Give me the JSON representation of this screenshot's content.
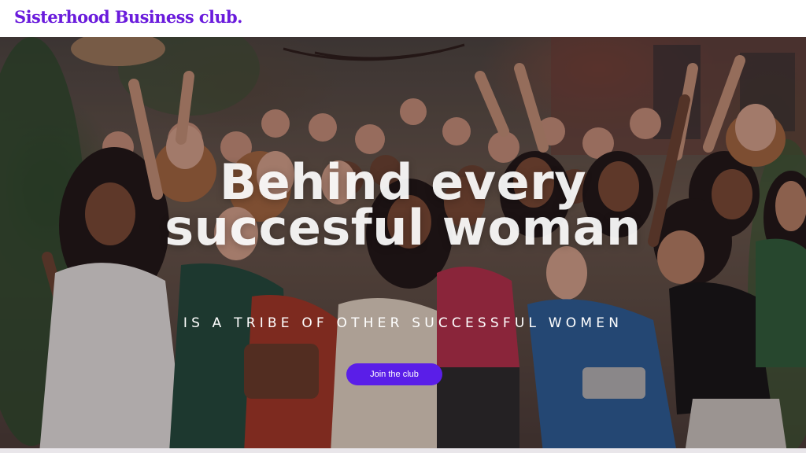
{
  "header": {
    "logo_text": "Sisterhood Business club."
  },
  "hero": {
    "headline_line1": "Behind every",
    "headline_line2": "succesful woman",
    "tagline": "IS A TRIBE OF OTHER SUCCESSFUL WOMEN",
    "cta_label": "Join the club"
  },
  "colors": {
    "brand_purple": "#6a1bdc",
    "button_purple": "#5a1ee8"
  }
}
